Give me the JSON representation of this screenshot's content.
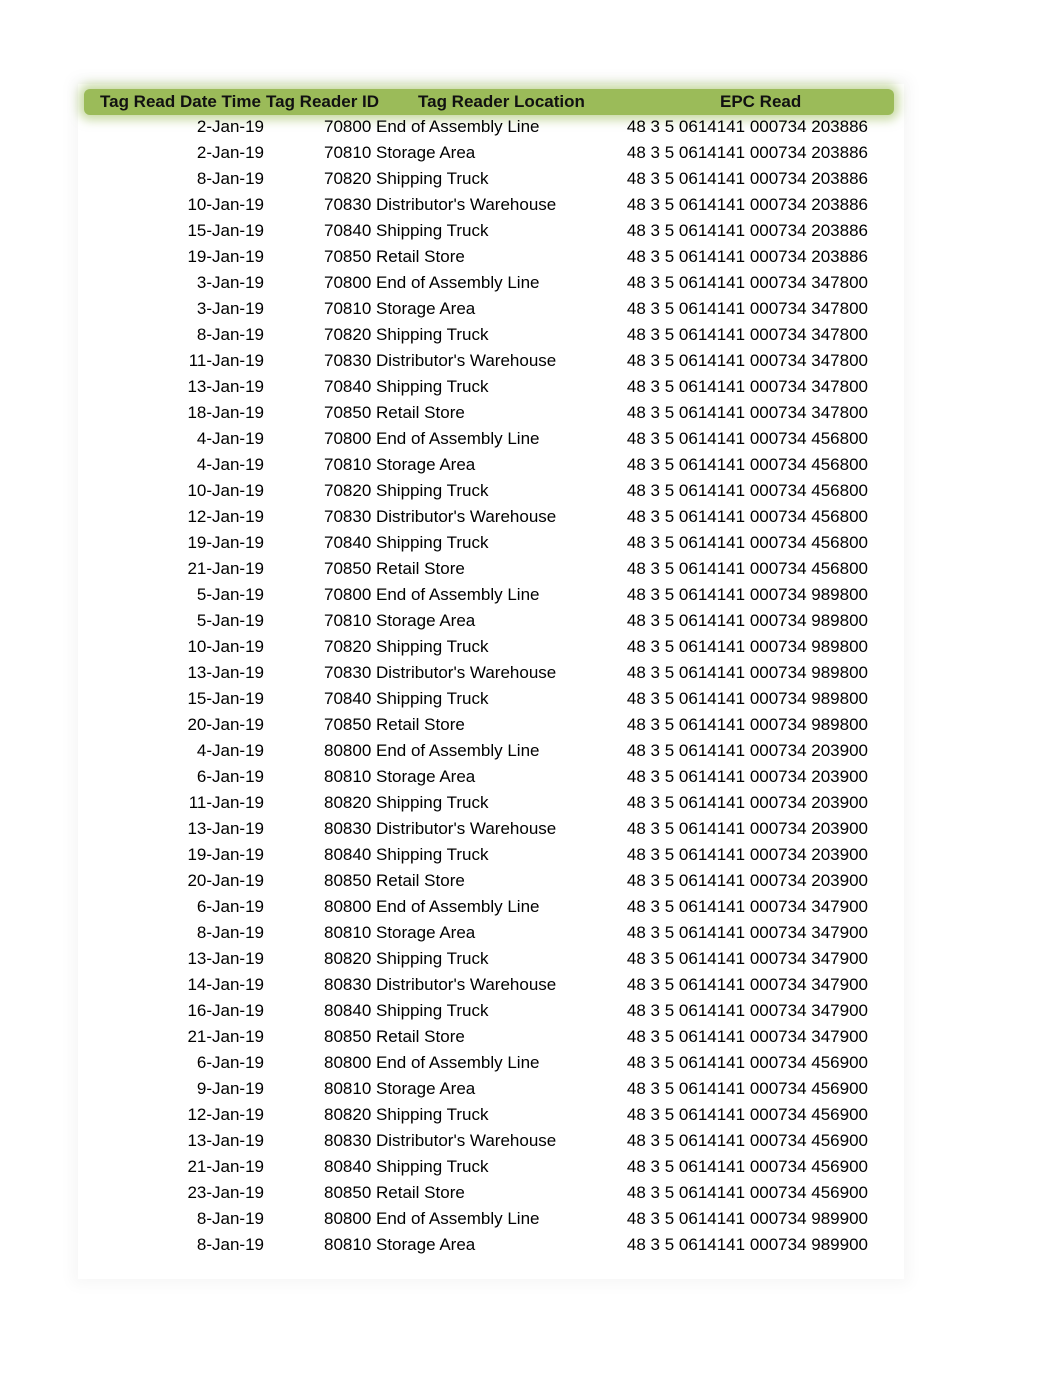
{
  "table": {
    "headers": {
      "date": "Tag Read Date Time",
      "reader_id": "Tag Reader ID",
      "location": "Tag Reader Location",
      "epc": "EPC Read"
    },
    "header_color": "#9bbb59",
    "rows": [
      {
        "date": "2-Jan-19",
        "id": "70800",
        "loc": "End of Assembly Line",
        "epc": "48 3 5 0614141 000734 203886"
      },
      {
        "date": "2-Jan-19",
        "id": "70810",
        "loc": "Storage Area",
        "epc": "48 3 5 0614141 000734 203886"
      },
      {
        "date": "8-Jan-19",
        "id": "70820",
        "loc": "Shipping Truck",
        "epc": "48 3 5 0614141 000734 203886"
      },
      {
        "date": "10-Jan-19",
        "id": "70830",
        "loc": "Distributor's Warehouse",
        "epc": "48 3 5 0614141 000734 203886"
      },
      {
        "date": "15-Jan-19",
        "id": "70840",
        "loc": "Shipping Truck",
        "epc": "48 3 5 0614141 000734 203886"
      },
      {
        "date": "19-Jan-19",
        "id": "70850",
        "loc": "Retail Store",
        "epc": "48 3 5 0614141 000734 203886"
      },
      {
        "date": "3-Jan-19",
        "id": "70800",
        "loc": "End of Assembly Line",
        "epc": "48 3 5 0614141 000734 347800"
      },
      {
        "date": "3-Jan-19",
        "id": "70810",
        "loc": "Storage Area",
        "epc": "48 3 5 0614141 000734 347800"
      },
      {
        "date": "8-Jan-19",
        "id": "70820",
        "loc": "Shipping Truck",
        "epc": "48 3 5 0614141 000734 347800"
      },
      {
        "date": "11-Jan-19",
        "id": "70830",
        "loc": "Distributor's Warehouse",
        "epc": "48 3 5 0614141 000734 347800"
      },
      {
        "date": "13-Jan-19",
        "id": "70840",
        "loc": "Shipping Truck",
        "epc": "48 3 5 0614141 000734 347800"
      },
      {
        "date": "18-Jan-19",
        "id": "70850",
        "loc": "Retail Store",
        "epc": "48 3 5 0614141 000734 347800"
      },
      {
        "date": "4-Jan-19",
        "id": "70800",
        "loc": "End of Assembly Line",
        "epc": "48 3 5 0614141 000734 456800"
      },
      {
        "date": "4-Jan-19",
        "id": "70810",
        "loc": "Storage Area",
        "epc": "48 3 5 0614141 000734 456800"
      },
      {
        "date": "10-Jan-19",
        "id": "70820",
        "loc": "Shipping Truck",
        "epc": "48 3 5 0614141 000734 456800"
      },
      {
        "date": "12-Jan-19",
        "id": "70830",
        "loc": "Distributor's Warehouse",
        "epc": "48 3 5 0614141 000734 456800"
      },
      {
        "date": "19-Jan-19",
        "id": "70840",
        "loc": "Shipping Truck",
        "epc": "48 3 5 0614141 000734 456800"
      },
      {
        "date": "21-Jan-19",
        "id": "70850",
        "loc": "Retail Store",
        "epc": "48 3 5 0614141 000734 456800"
      },
      {
        "date": "5-Jan-19",
        "id": "70800",
        "loc": "End of Assembly Line",
        "epc": "48 3 5 0614141 000734 989800"
      },
      {
        "date": "5-Jan-19",
        "id": "70810",
        "loc": "Storage Area",
        "epc": "48 3 5 0614141 000734 989800"
      },
      {
        "date": "10-Jan-19",
        "id": "70820",
        "loc": "Shipping Truck",
        "epc": "48 3 5 0614141 000734 989800"
      },
      {
        "date": "13-Jan-19",
        "id": "70830",
        "loc": "Distributor's Warehouse",
        "epc": "48 3 5 0614141 000734 989800"
      },
      {
        "date": "15-Jan-19",
        "id": "70840",
        "loc": "Shipping Truck",
        "epc": "48 3 5 0614141 000734 989800"
      },
      {
        "date": "20-Jan-19",
        "id": "70850",
        "loc": "Retail Store",
        "epc": "48 3 5 0614141 000734 989800"
      },
      {
        "date": "4-Jan-19",
        "id": "80800",
        "loc": "End of Assembly Line",
        "epc": "48 3 5 0614141 000734 203900"
      },
      {
        "date": "6-Jan-19",
        "id": "80810",
        "loc": "Storage Area",
        "epc": "48 3 5 0614141 000734 203900"
      },
      {
        "date": "11-Jan-19",
        "id": "80820",
        "loc": "Shipping Truck",
        "epc": "48 3 5 0614141 000734 203900"
      },
      {
        "date": "13-Jan-19",
        "id": "80830",
        "loc": "Distributor's Warehouse",
        "epc": "48 3 5 0614141 000734 203900"
      },
      {
        "date": "19-Jan-19",
        "id": "80840",
        "loc": "Shipping Truck",
        "epc": "48 3 5 0614141 000734 203900"
      },
      {
        "date": "20-Jan-19",
        "id": "80850",
        "loc": "Retail Store",
        "epc": "48 3 5 0614141 000734 203900"
      },
      {
        "date": "6-Jan-19",
        "id": "80800",
        "loc": "End of Assembly Line",
        "epc": "48 3 5 0614141 000734 347900"
      },
      {
        "date": "8-Jan-19",
        "id": "80810",
        "loc": "Storage Area",
        "epc": "48 3 5 0614141 000734 347900"
      },
      {
        "date": "13-Jan-19",
        "id": "80820",
        "loc": "Shipping Truck",
        "epc": "48 3 5 0614141 000734 347900"
      },
      {
        "date": "14-Jan-19",
        "id": "80830",
        "loc": "Distributor's Warehouse",
        "epc": "48 3 5 0614141 000734 347900"
      },
      {
        "date": "16-Jan-19",
        "id": "80840",
        "loc": "Shipping Truck",
        "epc": "48 3 5 0614141 000734 347900"
      },
      {
        "date": "21-Jan-19",
        "id": "80850",
        "loc": "Retail Store",
        "epc": "48 3 5 0614141 000734 347900"
      },
      {
        "date": "6-Jan-19",
        "id": "80800",
        "loc": "End of Assembly Line",
        "epc": "48 3 5 0614141 000734 456900"
      },
      {
        "date": "9-Jan-19",
        "id": "80810",
        "loc": "Storage Area",
        "epc": "48 3 5 0614141 000734 456900"
      },
      {
        "date": "12-Jan-19",
        "id": "80820",
        "loc": "Shipping Truck",
        "epc": "48 3 5 0614141 000734 456900"
      },
      {
        "date": "13-Jan-19",
        "id": "80830",
        "loc": "Distributor's Warehouse",
        "epc": "48 3 5 0614141 000734 456900"
      },
      {
        "date": "21-Jan-19",
        "id": "80840",
        "loc": "Shipping Truck",
        "epc": "48 3 5 0614141 000734 456900"
      },
      {
        "date": "23-Jan-19",
        "id": "80850",
        "loc": "Retail Store",
        "epc": "48 3 5 0614141 000734 456900"
      },
      {
        "date": "8-Jan-19",
        "id": "80800",
        "loc": "End of Assembly Line",
        "epc": "48 3 5 0614141 000734 989900"
      },
      {
        "date": "8-Jan-19",
        "id": "80810",
        "loc": "Storage Area",
        "epc": "48 3 5 0614141 000734 989900"
      }
    ]
  }
}
